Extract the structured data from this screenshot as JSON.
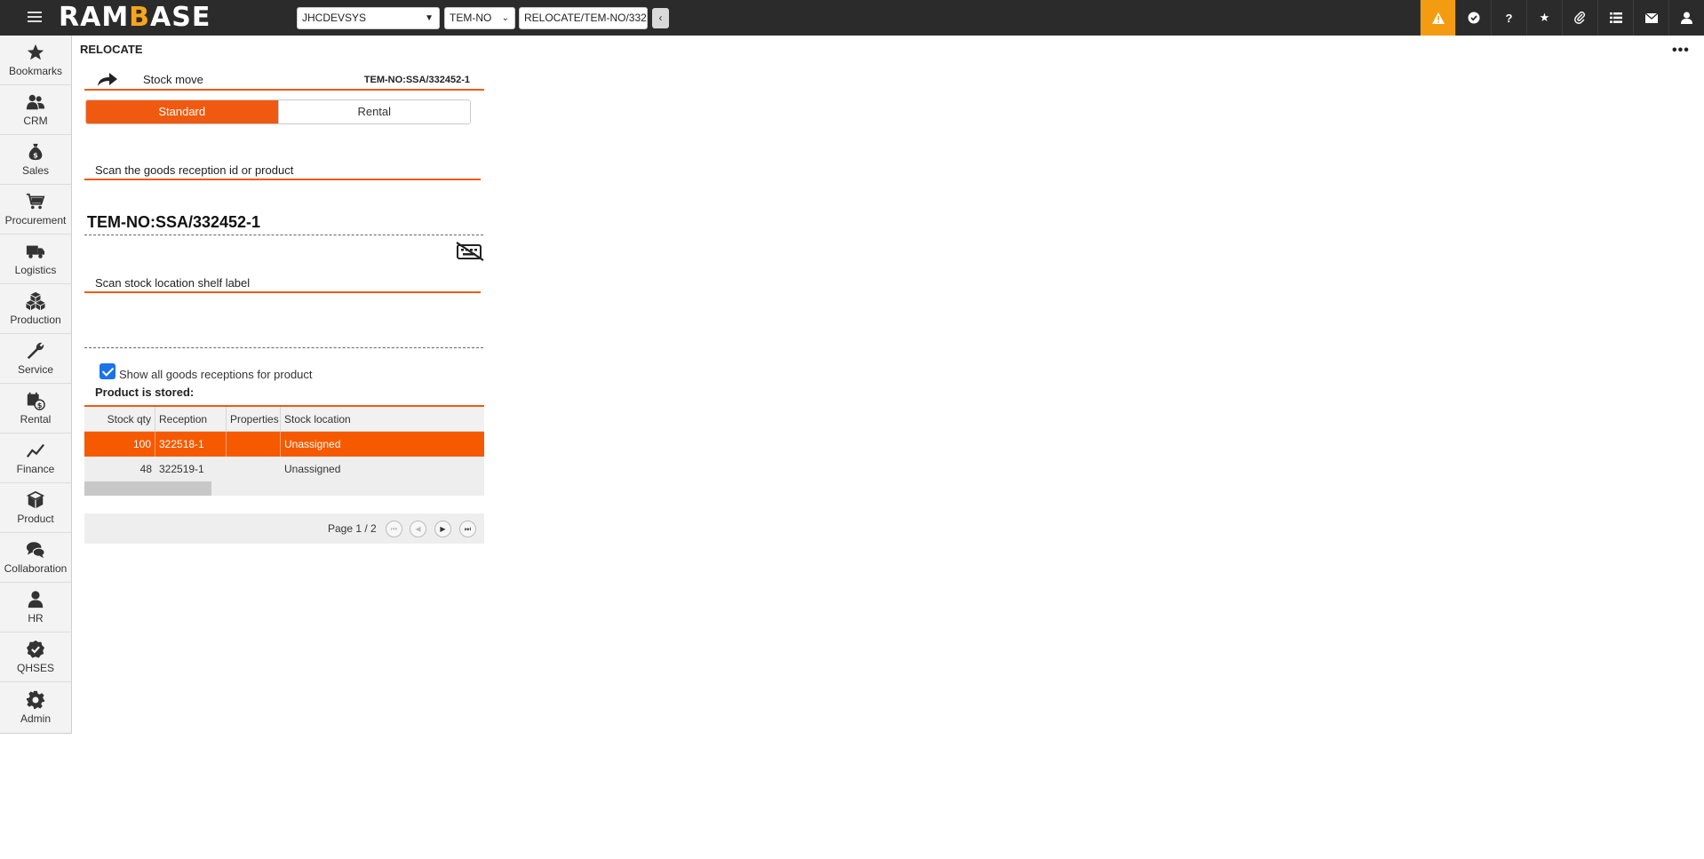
{
  "app": {
    "logo_main": "RAM",
    "logo_accent": "B",
    "logo_rest": "ASE"
  },
  "topbar": {
    "database": "JHCDEVSYS",
    "company": "TEM-NO",
    "path": "RELOCATE/TEM-NO/332",
    "back_symbol": "‹",
    "icons": [
      "alert-icon",
      "check-badge-icon",
      "help-icon",
      "star-icon",
      "attachment-icon",
      "list-icon",
      "mail-icon",
      "user-icon"
    ]
  },
  "sidebar": {
    "items": [
      {
        "label": "Bookmarks",
        "icon": "star-icon"
      },
      {
        "label": "CRM",
        "icon": "people-icon"
      },
      {
        "label": "Sales",
        "icon": "money-bag-icon"
      },
      {
        "label": "Procurement",
        "icon": "cart-icon"
      },
      {
        "label": "Logistics",
        "icon": "truck-icon"
      },
      {
        "label": "Production",
        "icon": "boxes-icon"
      },
      {
        "label": "Service",
        "icon": "wrench-icon"
      },
      {
        "label": "Rental",
        "icon": "rental-icon"
      },
      {
        "label": "Finance",
        "icon": "chart-line-icon"
      },
      {
        "label": "Product",
        "icon": "box-icon"
      },
      {
        "label": "Collaboration",
        "icon": "chat-icon"
      },
      {
        "label": "HR",
        "icon": "person-icon"
      },
      {
        "label": "QHSES",
        "icon": "check-badge-icon"
      },
      {
        "label": "Admin",
        "icon": "gear-icon"
      }
    ]
  },
  "main": {
    "page_title": "RELOCATE",
    "more_symbol": "•••",
    "header": {
      "title": "Stock move",
      "reference": "TEM-NO:SSA/332452-1"
    },
    "toggle": {
      "standard": "Standard",
      "rental": "Rental"
    },
    "scan_goods_label": "Scan the goods reception id or product",
    "scan_goods_value": "TEM-NO:SSA/332452-1",
    "scan_shelf_label": "Scan stock location shelf label",
    "show_all_label": "Show all goods receptions for product",
    "show_all_checked": true,
    "stored_label": "Product is stored:",
    "grid": {
      "columns": [
        "Stock qty",
        "Reception",
        "Properties",
        "Stock location"
      ],
      "rows": [
        {
          "qty": "100",
          "reception": "322518-1",
          "properties": "",
          "location": "Unassigned"
        },
        {
          "qty": "48",
          "reception": "322519-1",
          "properties": "",
          "location": "Unassigned"
        }
      ]
    },
    "pager": {
      "text": "Page 1 / 2"
    }
  },
  "colors": {
    "accent": "#f05a10",
    "alert": "#f39c12",
    "topbar": "#2b2b2b"
  }
}
